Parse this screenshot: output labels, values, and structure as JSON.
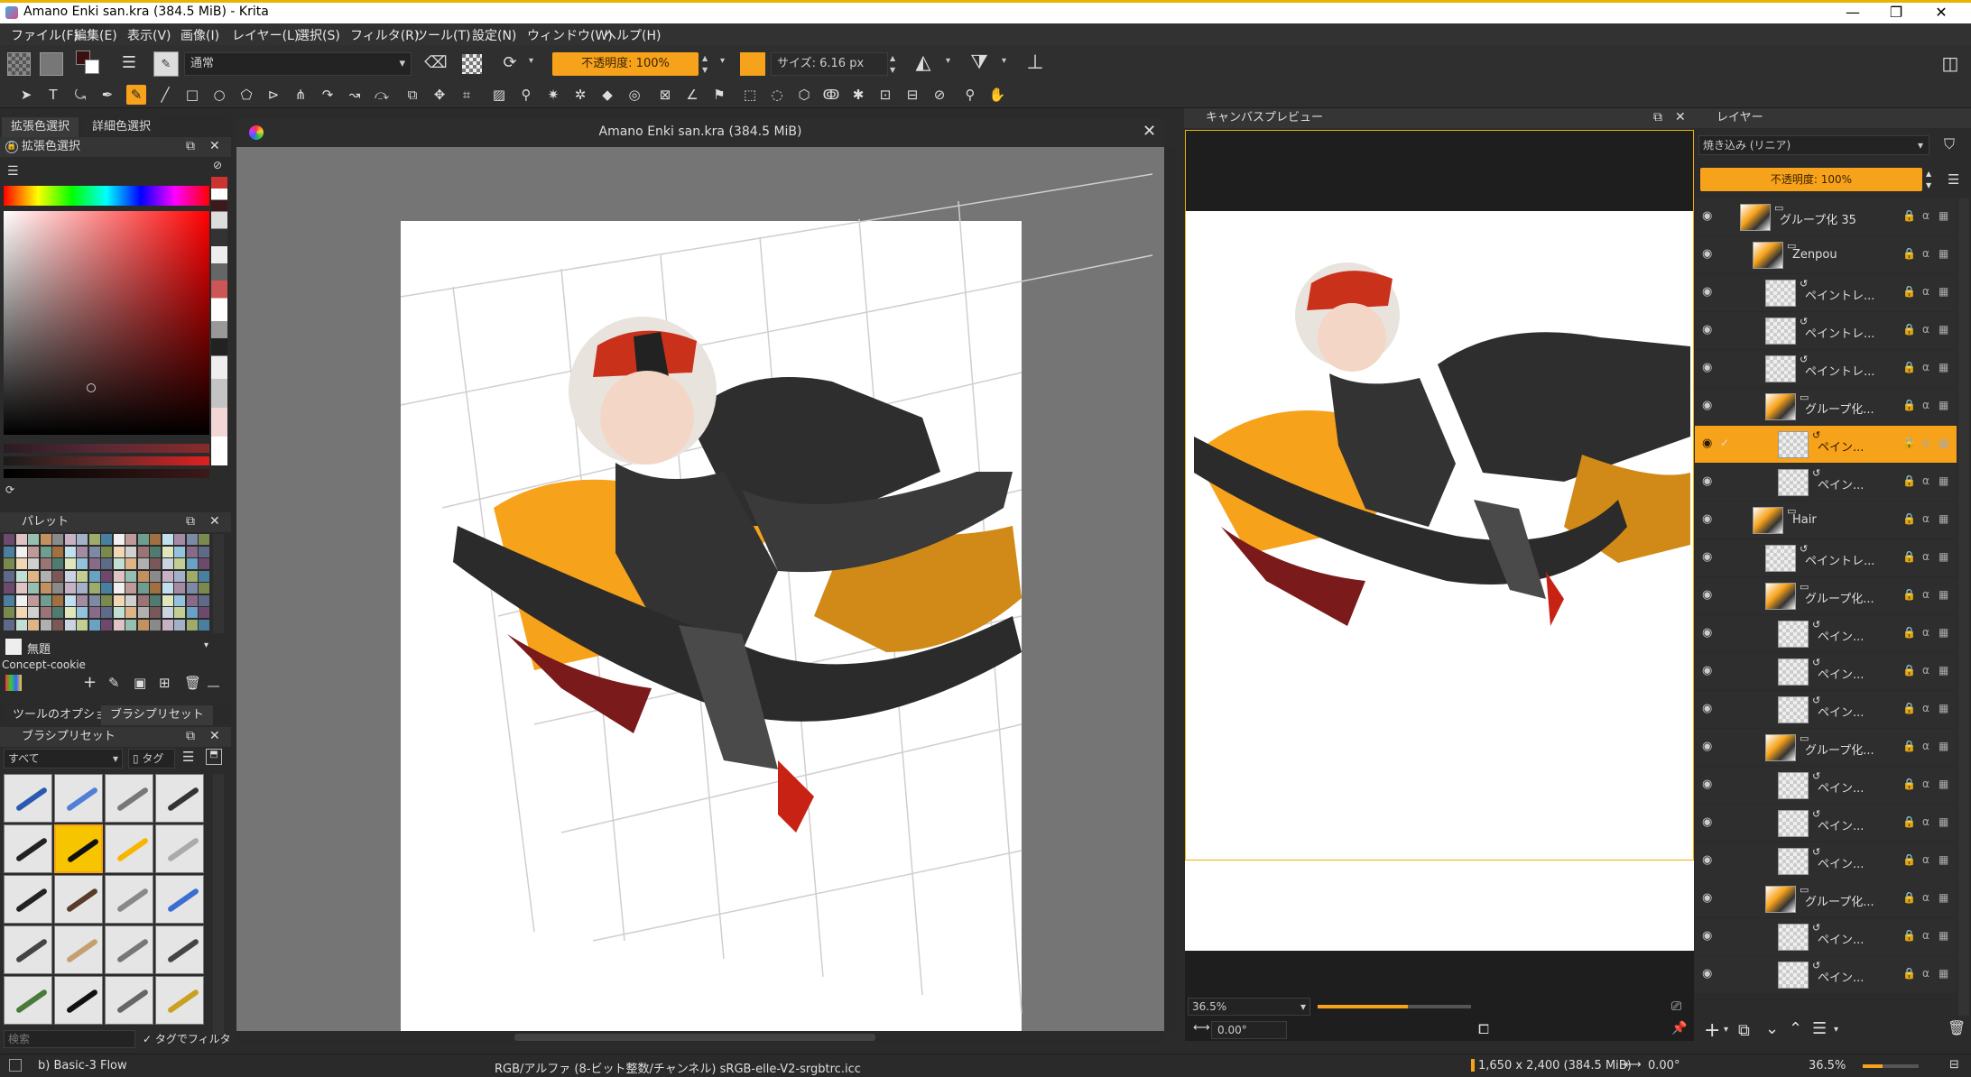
{
  "window": {
    "title": "Amano Enki san.kra (384.5 MiB)  - Krita",
    "min": "—",
    "max": "❐",
    "close": "✕"
  },
  "menu": [
    "ファイル(F)",
    "編集(E)",
    "表示(V)",
    "画像(I)",
    "レイヤー(L)",
    "選択(S)",
    "フィルタ(R)",
    "ツール(T)",
    "設定(N)",
    "ウィンドウ(W)",
    "ヘルプ(H)"
  ],
  "toolbar": {
    "blend_mode": "通常",
    "opacity": "不透明度: 100%",
    "size": "サイズ: 6.16 px",
    "accent": "#f7a21b"
  },
  "left_dock": {
    "tabs": [
      "拡張色選択",
      "詳細色選択"
    ],
    "color_panel_title": "拡張色選択",
    "palette_title": "パレット",
    "palette_swatch_label": "無題",
    "palette_name": "Concept-cookie",
    "bottom_tabs": [
      "ツールのオプション",
      "ブラシプリセット"
    ],
    "brush_panel_title": "ブラシプリセット",
    "brush_filter": "すべて",
    "brush_tag": "タグ",
    "search_placeholder": "検索",
    "filter_by_tag": "タグでフィルタ"
  },
  "document": {
    "title": "Amano Enki san.kra (384.5 MiB)"
  },
  "canvas_preview": {
    "title": "キャンバスプレビュー",
    "zoom": "36.5%",
    "rotation": "0.00°"
  },
  "layers": {
    "title": "レイヤー",
    "blend": "焼き込み (リニア)",
    "opacity": "不透明度: 100%",
    "items": [
      {
        "name": "グループ化 35"
      },
      {
        "name": "Zenpou"
      },
      {
        "name": "ペイントレ..."
      },
      {
        "name": "ペイントレ..."
      },
      {
        "name": "ペイントレ..."
      },
      {
        "name": "グループ化..."
      },
      {
        "name": "ペイン..."
      },
      {
        "name": "ペイン..."
      },
      {
        "name": "Hair"
      },
      {
        "name": "ペイントレ..."
      },
      {
        "name": "グループ化..."
      },
      {
        "name": "ペイン..."
      },
      {
        "name": "ペイン..."
      },
      {
        "name": "ペイン..."
      },
      {
        "name": "グループ化..."
      },
      {
        "name": "ペイン..."
      },
      {
        "name": "ペイン..."
      },
      {
        "name": "ペイン..."
      },
      {
        "name": "グループ化..."
      },
      {
        "name": "ペイン..."
      },
      {
        "name": "ペイン..."
      }
    ]
  },
  "status": {
    "brush": "b) Basic-3 Flow",
    "color_profile": "RGB/アルファ (8-ビット整数/チャンネル)  sRGB-elle-V2-srgbtrc.icc",
    "dimensions": "1,650 x 2,400 (384.5 MiB)",
    "rotation": "0.00°",
    "zoom": "36.5%"
  }
}
